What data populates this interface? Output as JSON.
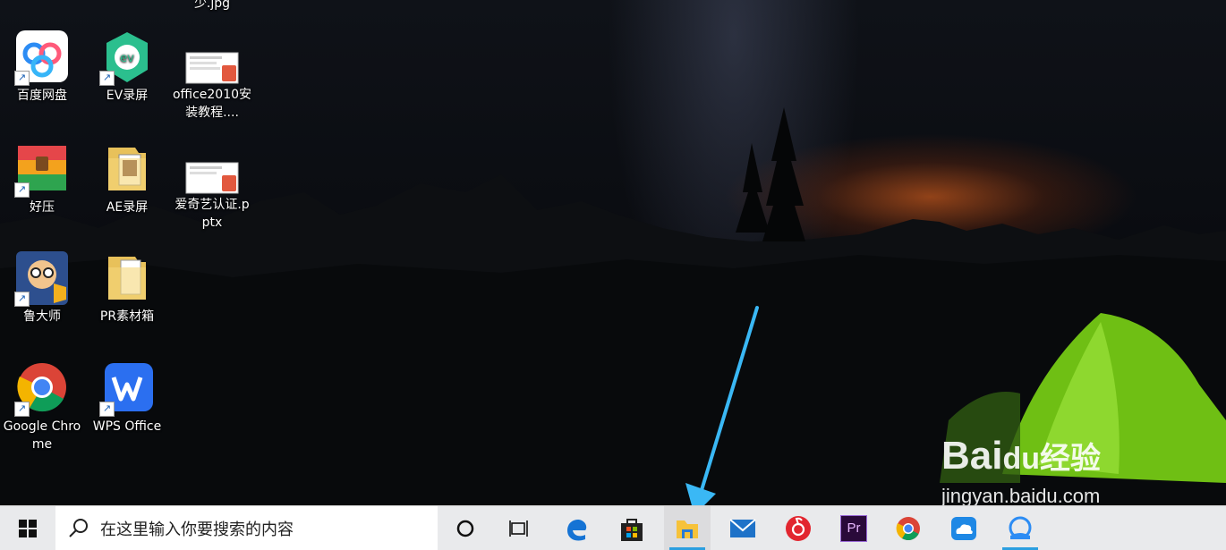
{
  "desktop": {
    "partial_top_label": "少.jpg",
    "icons": [
      {
        "label": "百度网盘",
        "icon": "baidu-netdisk-icon"
      },
      {
        "label": "EV录屏",
        "icon": "ev-recorder-icon"
      },
      {
        "label": "office2010安装教程....",
        "icon": "pptx-file-icon"
      },
      {
        "label": "好压",
        "icon": "haozip-icon"
      },
      {
        "label": "AE录屏",
        "icon": "folder-icon"
      },
      {
        "label": "爱奇艺认证.pptx",
        "icon": "pptx-file-icon"
      },
      {
        "label": "鲁大师",
        "icon": "ludashi-icon"
      },
      {
        "label": "PR素材箱",
        "icon": "folder-icon"
      },
      {
        "label": "Google Chrome",
        "icon": "chrome-icon"
      },
      {
        "label": "WPS Office",
        "icon": "wps-icon"
      }
    ],
    "shortcut_glyph": "↗"
  },
  "taskbar": {
    "search_placeholder": "在这里输入你要搜索的内容",
    "apps": [
      "cortana-icon",
      "task-view-icon",
      "edge-icon",
      "store-icon",
      "file-explorer-icon",
      "mail-icon",
      "netease-music-icon",
      "premiere-icon",
      "chrome-icon",
      "onedrive-icon",
      "baidu-netdisk-icon"
    ],
    "active_app": "file-explorer-icon",
    "premiere_text": "Pr"
  },
  "watermark": {
    "brand": "Bai",
    "brand_du": "du",
    "suffix": "经验",
    "url": "jingyan.baidu.com"
  },
  "annotation": {
    "arrow_color": "#3ab8f5"
  }
}
